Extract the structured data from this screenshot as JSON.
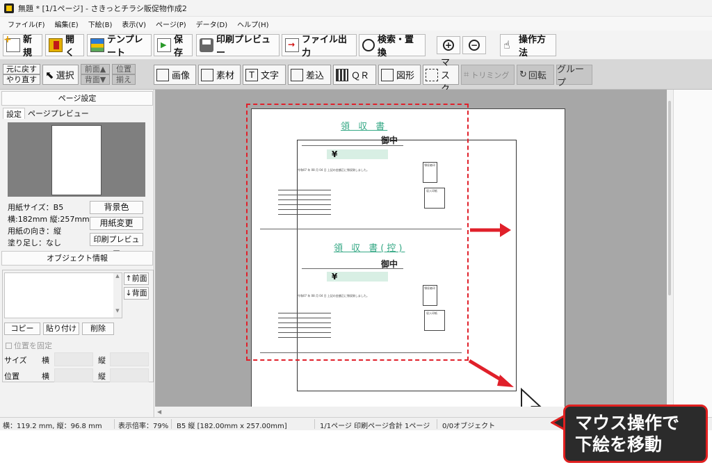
{
  "window": {
    "title": "無題 * [1/1ページ] - さきっとチラシ販促物作成2"
  },
  "menu": [
    {
      "label": "ファイル(F)"
    },
    {
      "label": "編集(E)"
    },
    {
      "label": "下絵(B)"
    },
    {
      "label": "表示(V)"
    },
    {
      "label": "ページ(P)"
    },
    {
      "label": "データ(D)"
    },
    {
      "label": "ヘルプ(H)"
    }
  ],
  "toolbar": {
    "new": "新規",
    "open": "開く",
    "template": "テンプレート",
    "save": "保存",
    "print_preview": "印刷プレビュー",
    "export": "ファイル出力",
    "search_replace": "検索・置換",
    "zoom_in": "+",
    "zoom_out": "−",
    "howto": "操作方法"
  },
  "toolbar2": {
    "undo": "元に戻す",
    "redo": "やり直す",
    "select": "選択",
    "front": "前面▲",
    "back": "背面▼",
    "align1": "位置",
    "align2": "揃え",
    "image": "画像",
    "material": "素材",
    "text": "文字",
    "insert": "差込",
    "qr": "ＱＲ",
    "shape": "図形",
    "mask": "マスク",
    "trimming": "トリミング",
    "rotate": "回転",
    "group": "グループ"
  },
  "page_settings": {
    "header": "ページ設定",
    "tab_settings": "設定",
    "tab_preview": "ページプレビュー",
    "paper_size": "用紙サイズ：B5",
    "dimensions": "横:182mm 縦:257mm",
    "orientation": "用紙の向き：縦",
    "bleed": "塗り足し：なし",
    "bg_color_btn": "背景色",
    "change_paper_btn": "用紙変更",
    "print_preview_btn": "印刷プレビュー"
  },
  "object_info": {
    "header": "オブジェクト情報",
    "front_btn": "↑前面",
    "back_btn": "↓背面",
    "copy_btn": "コピー",
    "paste_btn": "貼り付け",
    "delete_btn": "削除",
    "lock_label": "位置を固定",
    "size_label": "サイズ",
    "position_label": "位置",
    "width_label": "横",
    "height_label": "縦",
    "scroll_up": "▲",
    "scroll_down": "▼"
  },
  "canvas": {
    "scroll_left": "◀",
    "receipt1_title": "領 収 書",
    "receipt2_title": "領 収 書(控)",
    "gochu": "御中",
    "yen": "¥",
    "date_line": "令和07 年 08 月 04 日 上記の金額正に領収致しました。",
    "stamp_label": "領収者印",
    "revenue_label": "収入印紙"
  },
  "status": {
    "coords": "横：119.2 mm, 縦：96.8 mm",
    "zoom": "表示倍率：79%",
    "paper": "B5 縦 [182.00mm x 257.00mm]",
    "pages": "1/1ページ 印刷ページ合計 1ページ",
    "objects": "0/0オブジェクト"
  },
  "callout": {
    "line1": "マウス操作で",
    "line2": "下絵を移動"
  },
  "colors": {
    "accent_red": "#e0202a",
    "receipt_green": "#35a885"
  }
}
